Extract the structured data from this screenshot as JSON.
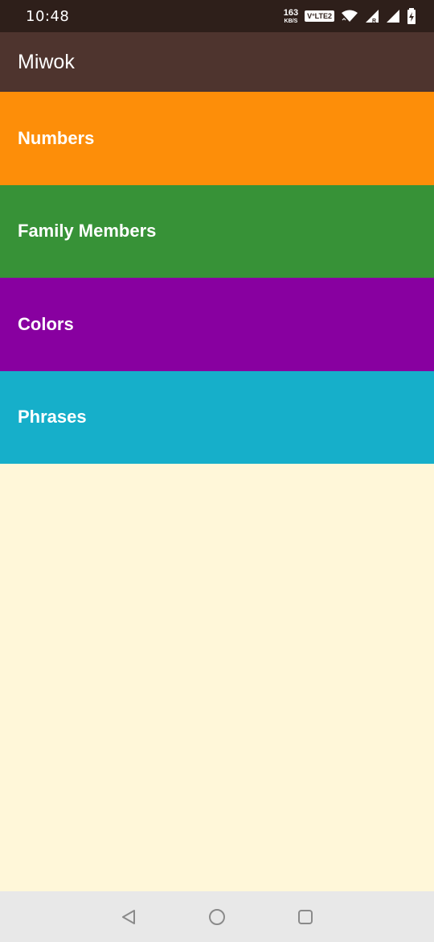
{
  "status_bar": {
    "time": "10:48",
    "net_speed_value": "163",
    "net_speed_unit": "KB/S",
    "volte_badge": "V°LTE2",
    "icons": [
      "wifi-icon",
      "signal-roaming-icon",
      "signal-icon",
      "battery-charging-icon"
    ]
  },
  "app_bar": {
    "title": "Miwok"
  },
  "categories": [
    {
      "label": "Numbers",
      "color": "#FD8E09"
    },
    {
      "label": "Family Members",
      "color": "#379237"
    },
    {
      "label": "Colors",
      "color": "#8800A0"
    },
    {
      "label": "Phrases",
      "color": "#16AFCA"
    }
  ],
  "content_background": "#FFF7D9",
  "nav_bar": {
    "icons": [
      "back-icon",
      "home-icon",
      "recents-icon"
    ]
  }
}
